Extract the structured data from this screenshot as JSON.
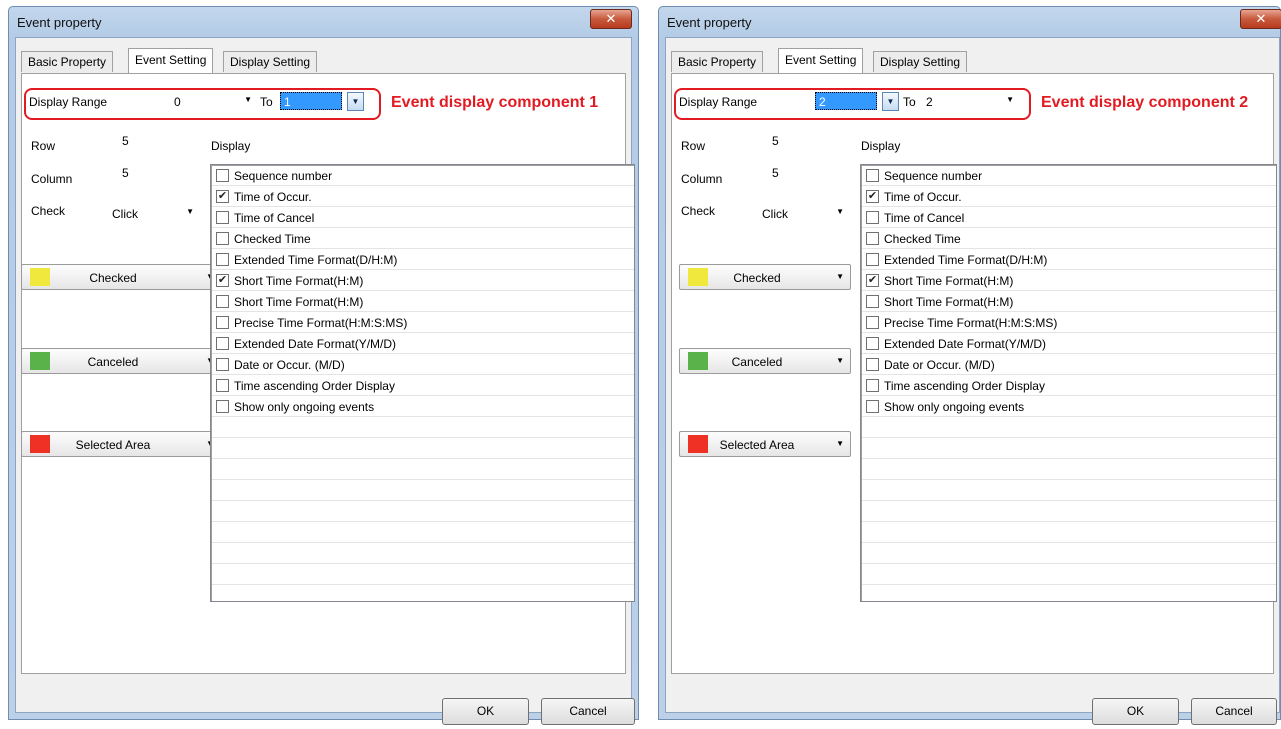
{
  "dialogs": [
    {
      "title": "Event property",
      "close_glyph": "✕",
      "tabs": [
        "Basic Property",
        "Event Setting",
        "Display Setting"
      ],
      "display_range_label": "Display Range",
      "range_from": "0",
      "to_label": "To",
      "range_to": "1",
      "callout": "Event display component 1",
      "row_label": "Row",
      "row_value": "5",
      "display_label": "Display",
      "column_label": "Column",
      "column_value": "5",
      "check_label": "Check",
      "check_value": "Click",
      "color_buttons": [
        {
          "label": "Checked",
          "color": "#f0e83c"
        },
        {
          "label": "Canceled",
          "color": "#5ab24a"
        },
        {
          "label": "Selected Area",
          "color": "#ee3124"
        }
      ],
      "display_items": [
        {
          "label": "Sequence number",
          "checked": false
        },
        {
          "label": "Time of Occur.",
          "checked": true
        },
        {
          "label": "Time of Cancel",
          "checked": false
        },
        {
          "label": "Checked Time",
          "checked": false
        },
        {
          "label": "Extended Time Format(D/H:M)",
          "checked": false
        },
        {
          "label": "Short Time Format(H:M)",
          "checked": true
        },
        {
          "label": "Short Time Format(H:M)",
          "checked": false
        },
        {
          "label": "Precise Time Format(H:M:S:MS)",
          "checked": false
        },
        {
          "label": "Extended Date Format(Y/M/D)",
          "checked": false
        },
        {
          "label": "Date or Occur.  (M/D)",
          "checked": false
        },
        {
          "label": "Time ascending Order Display",
          "checked": false
        },
        {
          "label": "Show only ongoing events",
          "checked": false
        }
      ],
      "ok_label": "OK",
      "cancel_label": "Cancel"
    },
    {
      "title": "Event property",
      "close_glyph": "✕",
      "tabs": [
        "Basic Property",
        "Event Setting",
        "Display Setting"
      ],
      "display_range_label": "Display Range",
      "range_from": "2",
      "to_label": "To",
      "range_to": "2",
      "callout": "Event display component 2",
      "row_label": "Row",
      "row_value": "5",
      "display_label": "Display",
      "column_label": "Column",
      "column_value": "5",
      "check_label": "Check",
      "check_value": "Click",
      "color_buttons": [
        {
          "label": "Checked",
          "color": "#f0e83c"
        },
        {
          "label": "Canceled",
          "color": "#5ab24a"
        },
        {
          "label": "Selected Area",
          "color": "#ee3124"
        }
      ],
      "display_items": [
        {
          "label": "Sequence number",
          "checked": false
        },
        {
          "label": "Time of Occur.",
          "checked": true
        },
        {
          "label": "Time of Cancel",
          "checked": false
        },
        {
          "label": "Checked Time",
          "checked": false
        },
        {
          "label": "Extended Time Format(D/H:M)",
          "checked": false
        },
        {
          "label": "Short Time Format(H:M)",
          "checked": true
        },
        {
          "label": "Short Time Format(H:M)",
          "checked": false
        },
        {
          "label": "Precise Time Format(H:M:S:MS)",
          "checked": false
        },
        {
          "label": "Extended Date Format(Y/M/D)",
          "checked": false
        },
        {
          "label": "Date or Occur.  (M/D)",
          "checked": false
        },
        {
          "label": "Time ascending Order Display",
          "checked": false
        },
        {
          "label": "Show only ongoing events",
          "checked": false
        }
      ],
      "ok_label": "OK",
      "cancel_label": "Cancel"
    }
  ],
  "colors": {
    "callout_red": "#e21b23",
    "selection_blue": "#3399ff"
  }
}
